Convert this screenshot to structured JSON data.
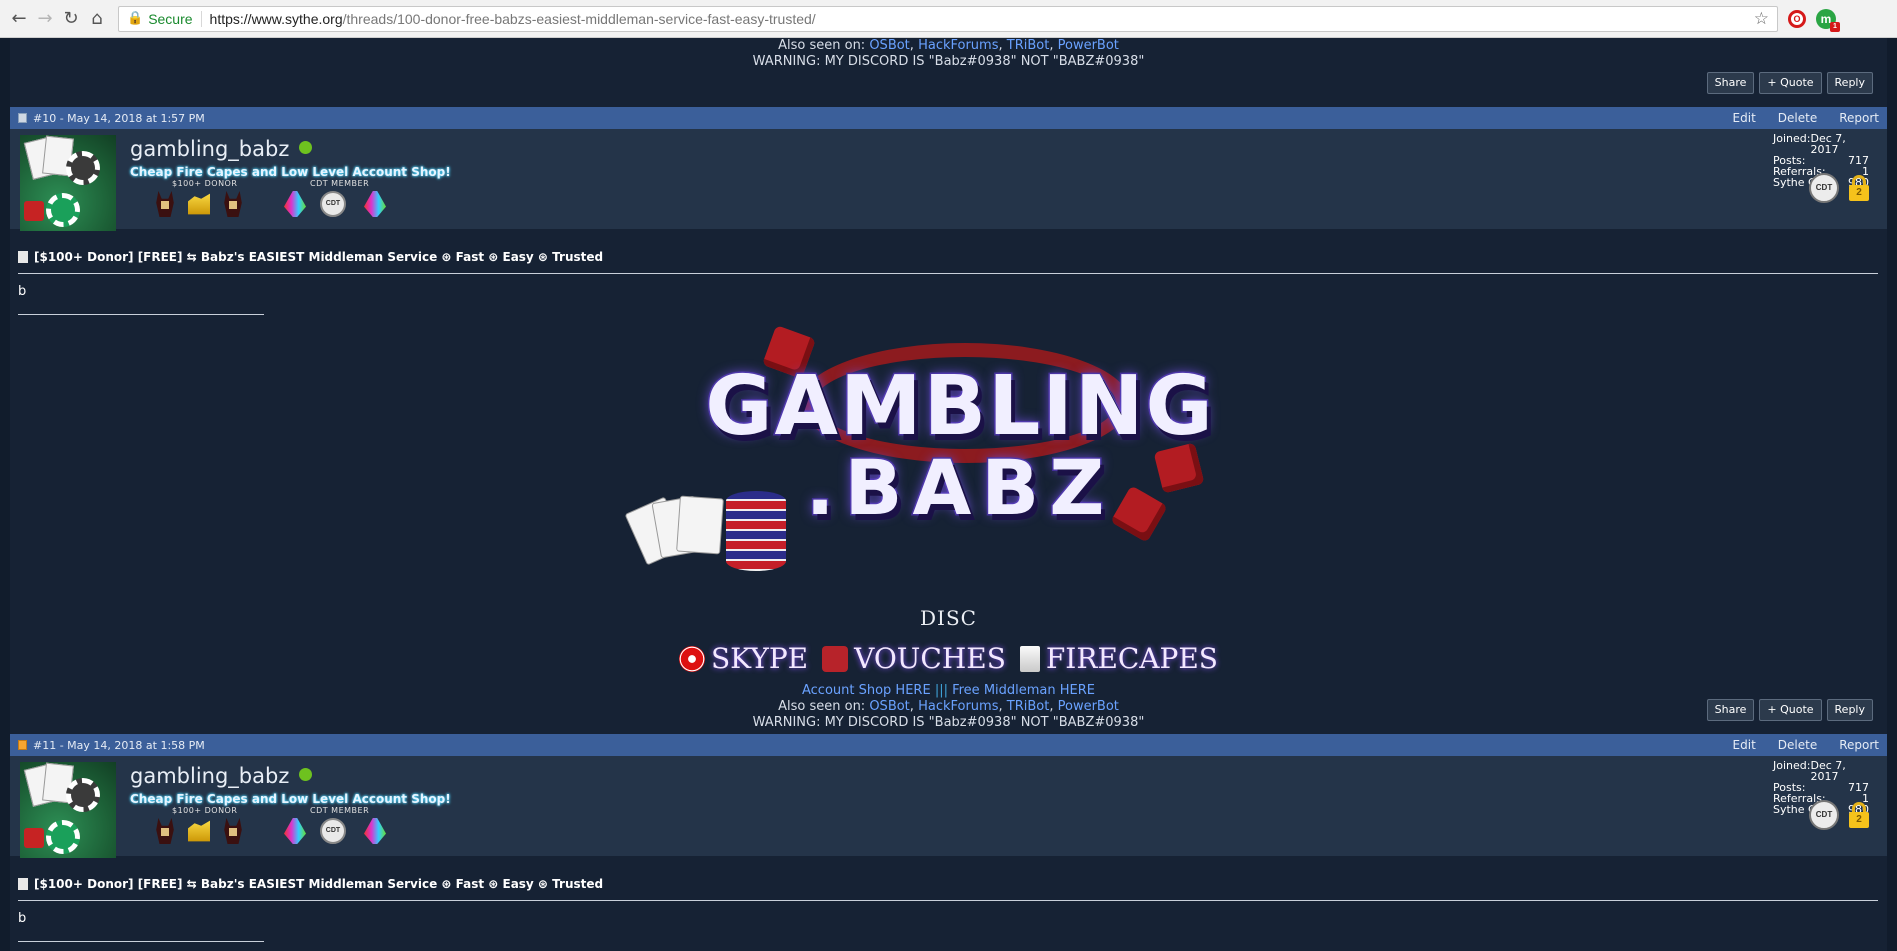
{
  "browser": {
    "secure_label": "Secure",
    "url_host": "https://www.sythe.org",
    "url_path": "/threads/100-donor-free-babzs-easiest-middleman-service-fast-easy-trusted/",
    "opera_label": "O",
    "ext_label": "m",
    "ext_badge": "1"
  },
  "signature": {
    "account_shop": "Account Shop HERE",
    "divider": "|||",
    "free_middleman": "Free Middleman HERE",
    "also_seen_prefix": "Also seen on:",
    "also_seen_sites": [
      "OSBot",
      "HackForums",
      "TRiBot",
      "PowerBot"
    ],
    "comma": ",",
    "warning": "WARNING: MY DISCORD IS \"Babz#0938\" NOT \"BABZ#0938\""
  },
  "actions": {
    "share": "Share",
    "quote": "+ Quote",
    "reply": "Reply"
  },
  "post_links": {
    "edit": "Edit",
    "delete": "Delete",
    "report": "Report"
  },
  "user": {
    "name": "gambling_babz",
    "title": "Cheap Fire Capes and Low Level Account Shop!",
    "badge_donor": "$100+ DONOR",
    "badge_cdt": "CDT MEMBER",
    "cdt_icon_text": "CDT",
    "lock_text": "2",
    "stats": {
      "joined_label": "Joined:",
      "joined": "Dec 7, 2017",
      "posts_label": "Posts:",
      "posts": "717",
      "referrals_label": "Referrals:",
      "referrals": "1",
      "gold_label": "Sythe Gold:",
      "gold": "980"
    }
  },
  "posts": [
    {
      "header": "#10 - May 14, 2018 at 1:57 PM"
    },
    {
      "header": "#11 - May 14, 2018 at 1:58 PM"
    }
  ],
  "thread_title": "[$100+ Donor] [FREE] ⇆ Babz's EASIEST Middleman Service ⊛ Fast ⊛ Easy ⊛ Trusted",
  "post_body": "b",
  "banner": {
    "line1": "GAMBLING",
    "line2": ".BABZ",
    "discord": "DISC",
    "skype": "SKYPE",
    "vouches": "VOUCHES",
    "firecapes": "FIRECAPES"
  }
}
